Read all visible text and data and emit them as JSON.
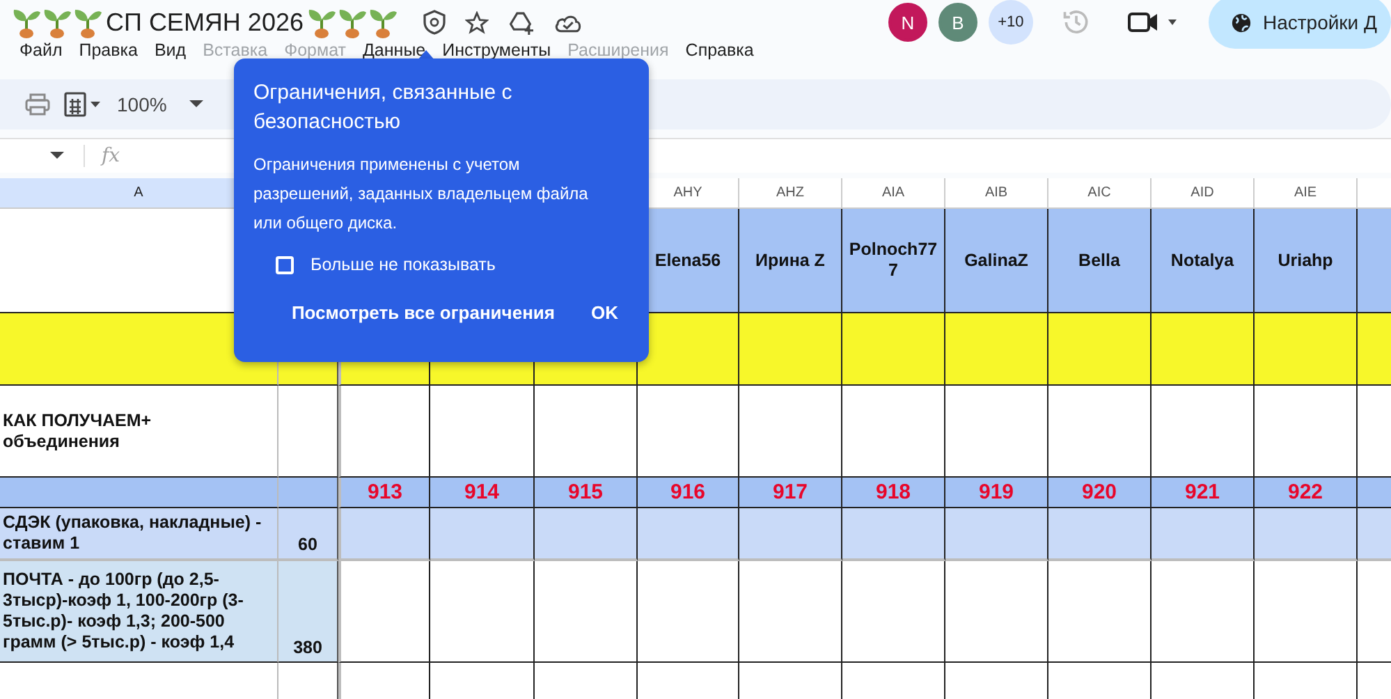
{
  "document": {
    "title": "СП СЕМЯН 2026"
  },
  "menu": [
    {
      "label": "Файл",
      "disabled": false
    },
    {
      "label": "Правка",
      "disabled": false
    },
    {
      "label": "Вид",
      "disabled": false
    },
    {
      "label": "Вставка",
      "disabled": true
    },
    {
      "label": "Формат",
      "disabled": true
    },
    {
      "label": "Данные",
      "disabled": false
    },
    {
      "label": "Инструменты",
      "disabled": false
    },
    {
      "label": "Расширения",
      "disabled": true
    },
    {
      "label": "Справка",
      "disabled": false
    }
  ],
  "collaborators": [
    {
      "initial": "N",
      "color": "#c2185b"
    },
    {
      "initial": "B",
      "color": "#5f8a78"
    }
  ],
  "more_collaborators": "+10",
  "share_button": "Настройки Д",
  "toolbar": {
    "zoom": "100%"
  },
  "formula_bar": {
    "fx": "fx"
  },
  "popup": {
    "title": "Ограничения, связанные с безопасностью",
    "body": "Ограничения применены с учетом разрешений, заданных владельцем файла или общего диска.",
    "checkbox": {
      "label": "Больше не показывать",
      "checked": false
    },
    "buttons": [
      "Посмотреть все ограничения",
      "OK"
    ]
  },
  "sheet": {
    "first_column": "A",
    "column_letters": [
      "AHY",
      "AHZ",
      "AIA",
      "AIB",
      "AIC",
      "AID",
      "AIE"
    ],
    "rows": [
      {
        "kind": "names",
        "values": [
          "Elena56",
          "Ирина Z",
          "Polnoch777",
          "GalinaZ",
          "Bella",
          "Notalya",
          "Uriahp"
        ]
      },
      {
        "kind": "highlight"
      },
      {
        "kind": "plain",
        "label": "КАК ПОЛУЧАЕМ+\nобъединения"
      },
      {
        "kind": "numbers",
        "values": [
          "913",
          "914",
          "915",
          "916",
          "917",
          "918",
          "919",
          "920",
          "921",
          "922"
        ]
      },
      {
        "kind": "shipping",
        "label": "СДЭК (упаковка, накладные) - ставим 1",
        "amount": "60"
      },
      {
        "kind": "post",
        "label": " ПОЧТА -  до 100гр (до 2,5-3тыср)-коэф 1, 100-200гр (3-5тыс.р)- коэф 1,3; 200-500 грамм (> 5тыс.р) - коэф 1,4",
        "amount": "380"
      },
      {
        "kind": "plain"
      }
    ]
  }
}
